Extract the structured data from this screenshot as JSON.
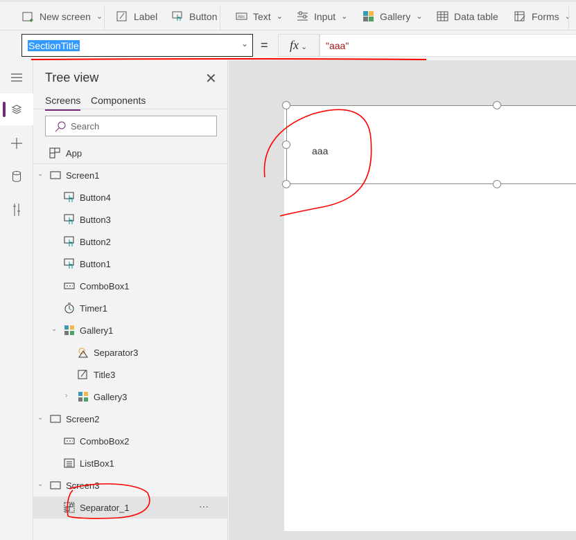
{
  "ribbon": {
    "items": [
      {
        "label": "New screen",
        "icon": "new-screen-icon",
        "dropdown": true
      },
      {
        "label": "Label",
        "icon": "label-icon",
        "dropdown": false
      },
      {
        "label": "Button",
        "icon": "button-icon",
        "dropdown": false
      },
      {
        "label": "Text",
        "icon": "text-icon",
        "dropdown": true
      },
      {
        "label": "Input",
        "icon": "input-icon",
        "dropdown": true
      },
      {
        "label": "Gallery",
        "icon": "gallery-icon",
        "dropdown": true
      },
      {
        "label": "Data table",
        "icon": "data-table-icon",
        "dropdown": false
      },
      {
        "label": "Forms",
        "icon": "forms-icon",
        "dropdown": true
      }
    ]
  },
  "formula_bar": {
    "property": "SectionTitle",
    "equals": "=",
    "fx": "fx",
    "formula": "\"aaa\""
  },
  "tree": {
    "title": "Tree view",
    "tabs": [
      "Screens",
      "Components"
    ],
    "active_tab": "Screens",
    "search_placeholder": "Search",
    "app_label": "App",
    "items": [
      {
        "label": "Screen1",
        "type": "screen",
        "level": 0,
        "expanded": true
      },
      {
        "label": "Button4",
        "type": "button",
        "level": 1
      },
      {
        "label": "Button3",
        "type": "button",
        "level": 1
      },
      {
        "label": "Button2",
        "type": "button",
        "level": 1
      },
      {
        "label": "Button1",
        "type": "button",
        "level": 1
      },
      {
        "label": "ComboBox1",
        "type": "combobox",
        "level": 1
      },
      {
        "label": "Timer1",
        "type": "timer",
        "level": 1
      },
      {
        "label": "Gallery1",
        "type": "gallery",
        "level": 1,
        "expanded": true
      },
      {
        "label": "Separator3",
        "type": "shape",
        "level": 2
      },
      {
        "label": "Title3",
        "type": "label",
        "level": 2
      },
      {
        "label": "Gallery3",
        "type": "gallery",
        "level": 2,
        "expanded": false
      },
      {
        "label": "Screen2",
        "type": "screen",
        "level": 0,
        "expanded": true
      },
      {
        "label": "ComboBox2",
        "type": "combobox",
        "level": 1
      },
      {
        "label": "ListBox1",
        "type": "listbox",
        "level": 1
      },
      {
        "label": "Screen3",
        "type": "screen",
        "level": 0,
        "expanded": true
      },
      {
        "label": "Separator_1",
        "type": "group",
        "level": 1,
        "selected": true
      }
    ],
    "more": "···"
  },
  "canvas": {
    "label_text": "aaa"
  },
  "colors": {
    "accent": "#742774",
    "selection": "#3399ff",
    "formula_string": "#a31515",
    "annotation": "#ff0000"
  }
}
